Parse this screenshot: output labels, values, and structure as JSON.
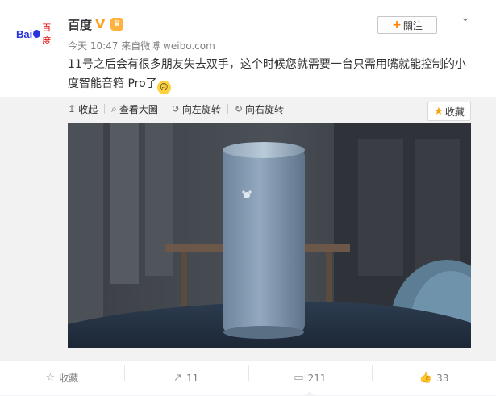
{
  "user": {
    "avatar_text_1": "Bai",
    "avatar_text_2": "百度",
    "name": "百度",
    "verified_badge": "V",
    "crown_badge": "♛",
    "time": "今天 10:47",
    "source": "来自微博 weibo.com",
    "follow_label": "關注",
    "follow_plus": "+",
    "menu_icon": "chevron-down-icon"
  },
  "post": {
    "text": "11号之后会有很多朋友失去双手，这个时候您就需要一台只需用嘴就能控制的小度智能音箱 Pro了",
    "emoji": "🙃"
  },
  "media_toolbar": {
    "collapse": "收起",
    "view_large": "查看大圖",
    "rotate_left": "向左旋转",
    "rotate_right": "向右旋转",
    "favorite": "收藏"
  },
  "footer": {
    "favorite": "收藏",
    "repost": "11",
    "comment": "211",
    "like": "33"
  },
  "colors": {
    "accent": "#ff8200",
    "star": "#f5a200",
    "speaker": "#7f98b3"
  }
}
